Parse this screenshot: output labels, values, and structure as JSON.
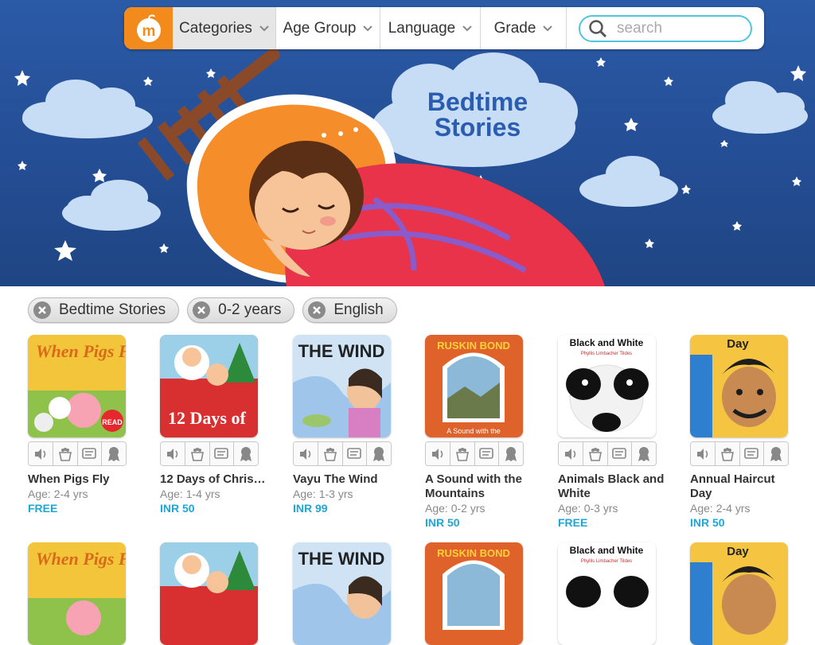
{
  "colors": {
    "brand_orange": "#f28a1c",
    "price_blue": "#1fa6d6",
    "search_border": "#4ec7dc",
    "hero_bg": "#2b5aa6"
  },
  "nav": {
    "logo_letter": "m",
    "dropdowns": [
      {
        "label": "Categories",
        "active": true
      },
      {
        "label": "Age Group"
      },
      {
        "label": "Language"
      },
      {
        "label": "Grade"
      }
    ],
    "search_placeholder": "search"
  },
  "hero": {
    "title_line1": "Bedtime",
    "title_line2": "Stories"
  },
  "filters": [
    {
      "label": "Bedtime Stories"
    },
    {
      "label": "0-2 years"
    },
    {
      "label": "English"
    }
  ],
  "books": [
    {
      "title": "When Pigs Fly",
      "age": "Age: 2-4 yrs",
      "price": "FREE",
      "cover_text": "When Pigs Fly",
      "read_badge": "READ"
    },
    {
      "title": "12 Days of Christ…",
      "age": "Age: 1-4 yrs",
      "price": "INR 50",
      "cover_text": "12 Days of"
    },
    {
      "title": "Vayu The Wind",
      "age": "Age: 1-3 yrs",
      "price": "INR 99",
      "cover_text": "THE WIND"
    },
    {
      "title": "A Sound with the Mountains",
      "age": "Age: 0-2 yrs",
      "price": "INR 50",
      "cover_text": "RUSKIN BOND",
      "cover_sub": "A Sound with the"
    },
    {
      "title": "Animals Black and White",
      "age": "Age: 0-3 yrs",
      "price": "FREE",
      "cover_text": "Black and White",
      "cover_sub": "Phyllis Limbacher Tildes"
    },
    {
      "title": "Annual Haircut Day",
      "age": "Age: 2-4 yrs",
      "price": "INR 50",
      "cover_text": "Day"
    }
  ],
  "action_icons": [
    "audio-icon",
    "animation-icon",
    "text-icon",
    "award-icon"
  ]
}
